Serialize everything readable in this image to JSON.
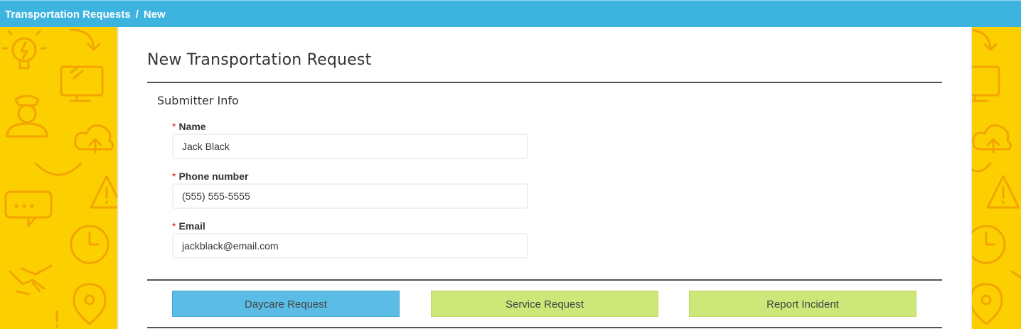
{
  "breadcrumb": {
    "parent": "Transportation Requests",
    "separator": "/",
    "current": "New"
  },
  "form": {
    "title": "New Transportation Request",
    "section": "Submitter Info",
    "required_marker": "*",
    "fields": {
      "name": {
        "label": "Name",
        "value": "Jack Black"
      },
      "phone": {
        "label": "Phone number",
        "value": "(555) 555-5555"
      },
      "email": {
        "label": "Email",
        "value": "jackblack@email.com"
      }
    }
  },
  "actions": {
    "daycare": "Daycare Request",
    "service": "Service Request",
    "incident": "Report Incident"
  },
  "colors": {
    "header": "#3db3e0",
    "sidebar": "#fcd000",
    "primary_button": "#5bbde6",
    "secondary_button": "#cde878",
    "required": "#cc2222"
  },
  "decorations": [
    "lightbulb-icon",
    "arrow-icon",
    "monitor-icon",
    "driver-icon",
    "cloud-upload-icon",
    "smile-icon",
    "warning-icon",
    "chat-rating-icon",
    "clock-icon",
    "handshake-icon",
    "location-pin-icon"
  ]
}
